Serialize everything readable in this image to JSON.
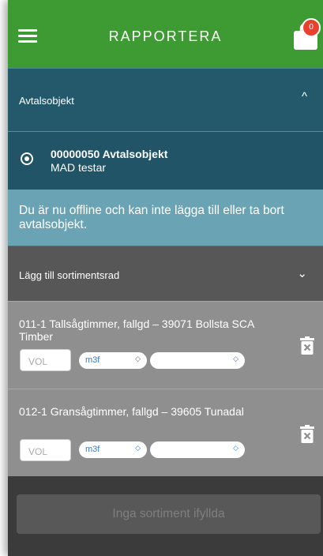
{
  "header": {
    "title": "RAPPORTERA",
    "cart_count": "0"
  },
  "avtal_section": {
    "label": "Avtalsobjekt",
    "chevron": "^"
  },
  "avtal_item": {
    "title": "00000050 Avtalsobjekt",
    "subtitle": "MAD testar"
  },
  "offline_message": "Du är nu offline och kan inte lägga till eller ta bort avtalsobjekt.",
  "sortiment_section": {
    "label": "Lägg till sortimentsrad",
    "chevron": "⌄"
  },
  "items": [
    {
      "name": "011-1 Tallsågtimmer, fallgd – 39071 Bollsta SCA Timber",
      "vol_placeholder": "VOL",
      "unit": "m3f",
      "unit_arrow": "◇",
      "second_select": "",
      "second_arrow": "◇"
    },
    {
      "name": "012-1 Gransågtimmer, fallgd – 39605 Tunadal",
      "vol_placeholder": "VOL",
      "unit": "m3f",
      "unit_arrow": "◇",
      "second_select": "",
      "second_arrow": "◇"
    }
  ],
  "footer": {
    "button_label": "Inga sortiment ifyllda"
  },
  "colors": {
    "header_green": "#3e9a33",
    "teal_dark": "#23596a",
    "teal_light": "#6aa4b4",
    "badge_red": "#e8412e"
  },
  "icons": {
    "menu": "hamburger-icon",
    "cart": "cart-icon",
    "delete": "trash-icon"
  }
}
